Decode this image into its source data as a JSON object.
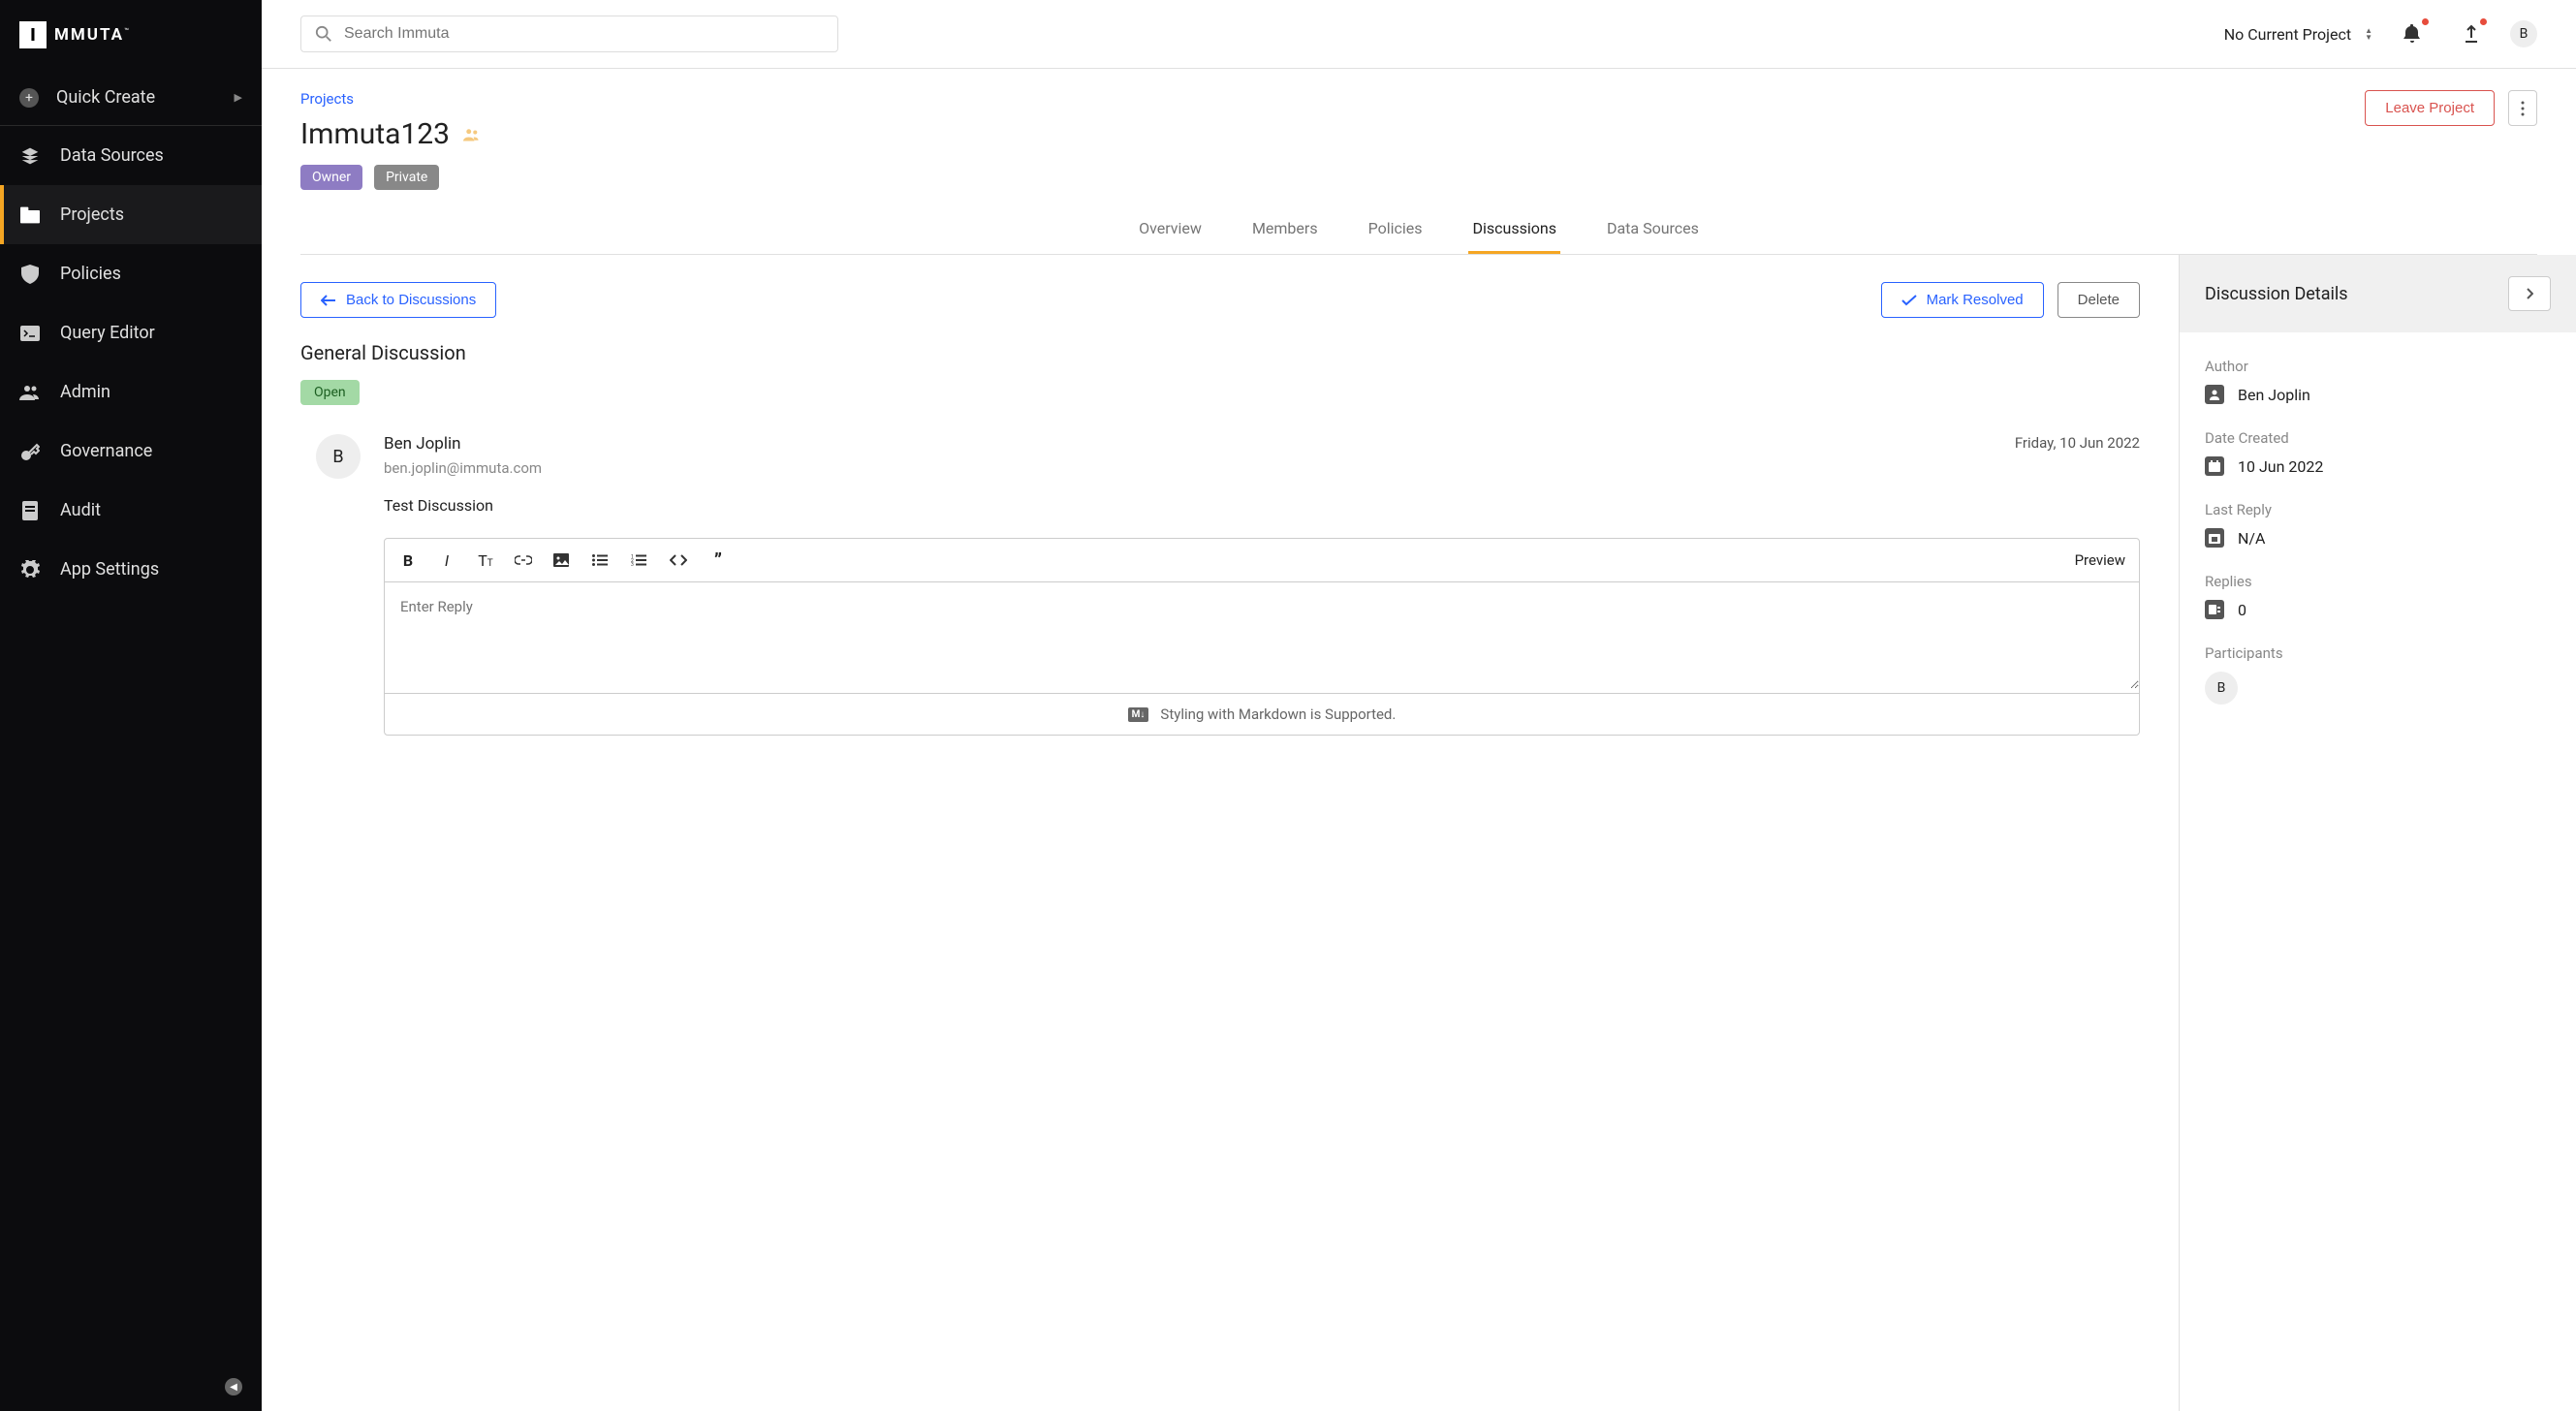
{
  "logo": {
    "text": "MMUTA"
  },
  "sidebar": {
    "quick_create": "Quick Create",
    "items": [
      {
        "label": "Data Sources"
      },
      {
        "label": "Projects"
      },
      {
        "label": "Policies"
      },
      {
        "label": "Query Editor"
      },
      {
        "label": "Admin"
      },
      {
        "label": "Governance"
      },
      {
        "label": "Audit"
      },
      {
        "label": "App Settings"
      }
    ]
  },
  "topbar": {
    "search_placeholder": "Search Immuta",
    "project_label": "No Current Project",
    "avatar_initial": "B"
  },
  "header": {
    "breadcrumb": "Projects",
    "title": "Immuta123",
    "badges": {
      "owner": "Owner",
      "private": "Private"
    },
    "leave_label": "Leave Project"
  },
  "tabs": [
    {
      "label": "Overview"
    },
    {
      "label": "Members"
    },
    {
      "label": "Policies"
    },
    {
      "label": "Discussions"
    },
    {
      "label": "Data Sources"
    }
  ],
  "discussion": {
    "back_label": "Back to Discussions",
    "mark_resolved_label": "Mark Resolved",
    "delete_label": "Delete",
    "title": "General Discussion",
    "status": "Open",
    "post": {
      "avatar": "B",
      "author": "Ben Joplin",
      "date": "Friday, 10 Jun 2022",
      "email": "ben.joplin@immuta.com",
      "content": "Test Discussion"
    },
    "editor": {
      "placeholder": "Enter Reply",
      "preview_label": "Preview",
      "footer_text": "Styling with Markdown is Supported."
    }
  },
  "details": {
    "title": "Discussion Details",
    "author_label": "Author",
    "author": "Ben Joplin",
    "date_created_label": "Date Created",
    "date_created": "10 Jun 2022",
    "last_reply_label": "Last Reply",
    "last_reply": "N/A",
    "replies_label": "Replies",
    "replies": "0",
    "participants_label": "Participants",
    "participants": [
      "B"
    ]
  }
}
